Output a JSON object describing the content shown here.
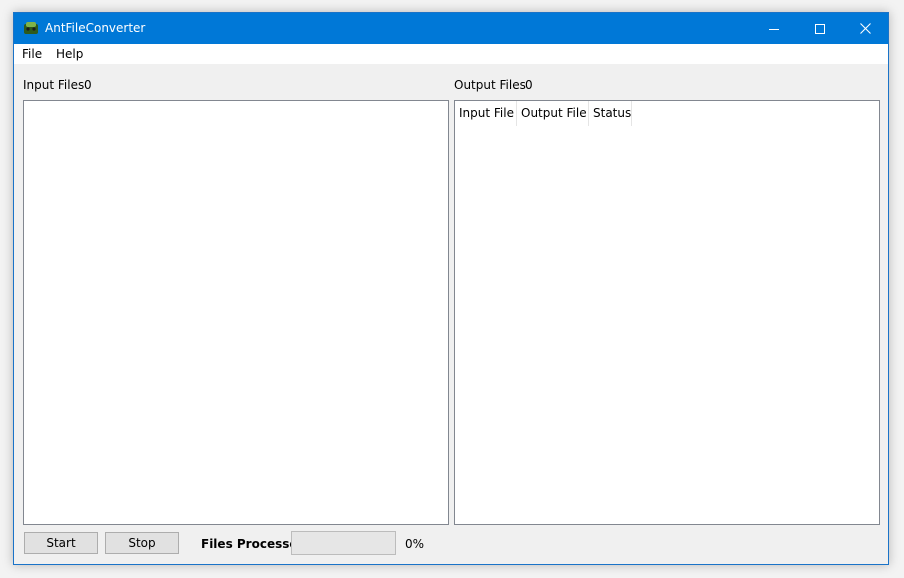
{
  "window": {
    "title": "AntFileConverter"
  },
  "menu": {
    "items": [
      "File",
      "Help"
    ]
  },
  "input_panel": {
    "label": "Input Files",
    "count": "0"
  },
  "output_panel": {
    "label": "Output Files",
    "count": "0",
    "columns": [
      "Input File",
      "Output File",
      "Status"
    ]
  },
  "footer": {
    "start_label": "Start",
    "stop_label": "Stop",
    "files_processed_label": "Files Processed",
    "progress_percent": 0,
    "progress_text": "0%"
  },
  "colors": {
    "titlebar": "#0078d7",
    "progress_fill": "#06b025"
  },
  "icons": {
    "app": "ant-app-icon",
    "minimize": "minimize-icon",
    "maximize": "maximize-icon",
    "close": "close-icon"
  }
}
